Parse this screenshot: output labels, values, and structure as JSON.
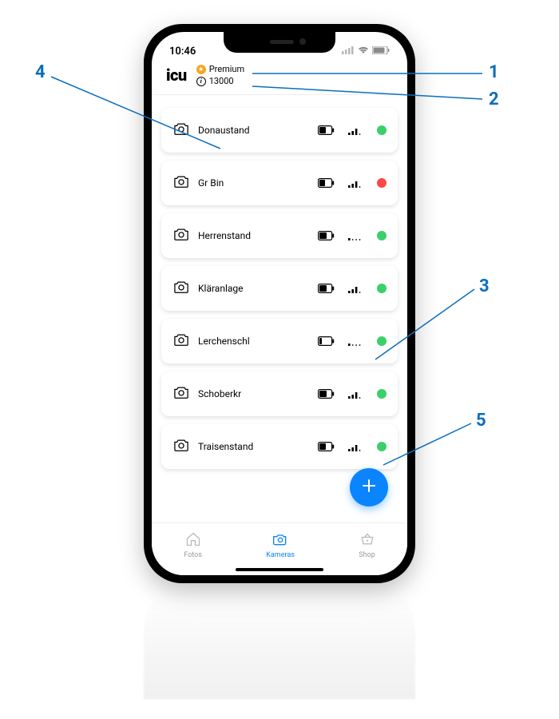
{
  "statusbar": {
    "time": "10:46"
  },
  "header": {
    "logo": "icu",
    "premium_label": "Premium",
    "points": "13000"
  },
  "cameras": [
    {
      "name": "Donaustand",
      "battery": 60,
      "signal": 3,
      "status": "green"
    },
    {
      "name": "Gr Bin",
      "battery": 50,
      "signal": 3,
      "status": "red"
    },
    {
      "name": "Herrenstand",
      "battery": 70,
      "signal": 1,
      "status": "green"
    },
    {
      "name": "Kläranlage",
      "battery": 70,
      "signal": 3,
      "status": "green"
    },
    {
      "name": "Lerchenschl",
      "battery": 20,
      "signal": 1,
      "status": "green"
    },
    {
      "name": "Schoberkr",
      "battery": 70,
      "signal": 3,
      "status": "green"
    },
    {
      "name": "Traisenstand",
      "battery": 60,
      "signal": 3,
      "status": "green"
    }
  ],
  "nav": {
    "fotos": "Fotos",
    "kameras": "Kameras",
    "shop": "Shop"
  },
  "callouts": {
    "1": "1",
    "2": "2",
    "3": "3",
    "4": "4",
    "5": "5"
  }
}
